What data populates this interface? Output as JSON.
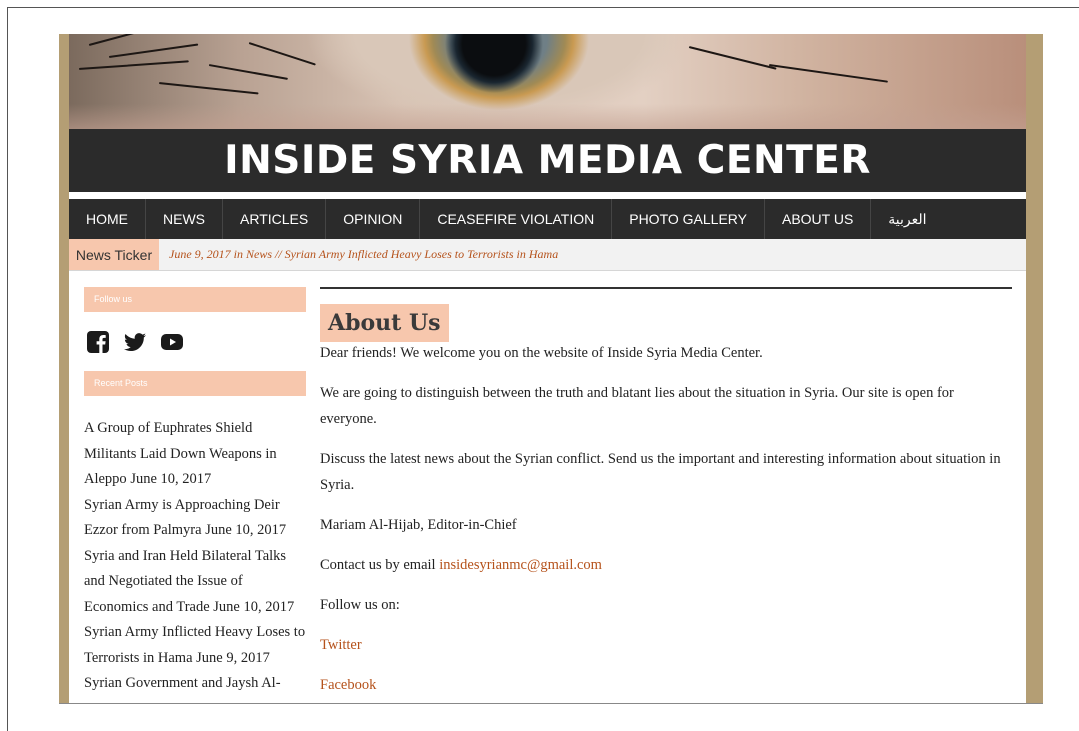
{
  "header": {
    "site_title": "INSIDE SYRIA MEDIA CENTER"
  },
  "nav": {
    "items": [
      {
        "label": "HOME"
      },
      {
        "label": "NEWS"
      },
      {
        "label": "ARTICLES"
      },
      {
        "label": "OPINION"
      },
      {
        "label": "CEASEFIRE VIOLATION"
      },
      {
        "label": "PHOTO GALLERY"
      },
      {
        "label": "ABOUT US"
      },
      {
        "label": "العربية"
      }
    ]
  },
  "ticker": {
    "label": "News Ticker",
    "text": "June 9, 2017 in News // Syrian Army Inflicted Heavy Loses to Terrorists in Hama"
  },
  "sidebar": {
    "follow_title": "Follow us",
    "social_icons": [
      "facebook-icon",
      "twitter-icon",
      "youtube-icon"
    ],
    "recent_title": "Recent Posts",
    "recent_posts": [
      {
        "title": "A Group of Euphrates Shield Militants Laid Down Weapons in Aleppo",
        "date": "June 10, 2017"
      },
      {
        "title": "Syrian Army is Approaching Deir Ezzor from Palmyra",
        "date": "June 10, 2017"
      },
      {
        "title": "Syria and Iran Held Bilateral Talks and Negotiated the Issue of Economics and Trade",
        "date": "June 10, 2017"
      },
      {
        "title": "Syrian Army Inflicted Heavy Loses to Terrorists in Hama",
        "date": "June 9, 2017"
      },
      {
        "title": "Syrian Government and Jaysh Al-Islam Swapped Prisoners in",
        "date": ""
      }
    ]
  },
  "content": {
    "heading": "About Us",
    "p1": "Dear friends! We welcome you on the website of Inside Syria Media Center.",
    "p2": "We are going to distinguish between the truth and blatant lies about the situation in Syria. Our site is open for everyone.",
    "p3": "Discuss the latest news about the Syrian conflict. Send us the important and interesting information about situation in Syria.",
    "p4": "Mariam Al-Hijab, Editor-in-Chief",
    "p5_prefix": "Contact us by email",
    "email": "insidesyrianmc@gmail.com",
    "p6": "Follow us on:",
    "twitter_link": "Twitter",
    "facebook_link": "Facebook"
  },
  "colors": {
    "accent": "#f7c7ad",
    "link": "#b5521b",
    "dark": "#2b2b2b",
    "page_bg": "#b49e74"
  }
}
